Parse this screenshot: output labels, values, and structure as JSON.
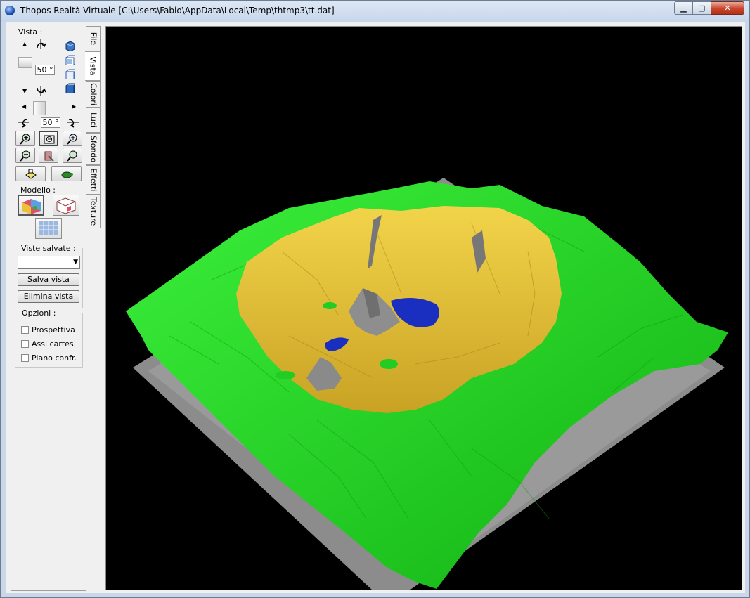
{
  "window": {
    "title": "Thopos Realtà Virtuale [C:\\Users\\Fabio\\AppData\\Local\\Temp\\thtmp3\\tt.dat]",
    "minimize_glyph": "▁",
    "maximize_glyph": "▢",
    "close_glyph": "✕"
  },
  "panel": {
    "vista_label": "Vista :",
    "vertical_angle": "50 °",
    "horizontal_angle": "50 °",
    "modello_label": "Modello :",
    "viste_salvate_label": "Viste salvate :",
    "salva_vista": "Salva vista",
    "elimina_vista": "Elimina vista",
    "opzioni_label": "Opzioni :",
    "options": [
      {
        "label": "Prospettiva",
        "checked": false
      },
      {
        "label": "Assi cartes.",
        "checked": false
      },
      {
        "label": "Piano confr.",
        "checked": false
      }
    ],
    "icons": {
      "rotate_up": "rotate-up-icon",
      "rotate_down": "rotate-down-icon",
      "rotate_left": "rotate-left-icon",
      "rotate_right": "rotate-right-icon",
      "zoom_in": "zoom-in-icon",
      "zoom_out": "zoom-out-icon",
      "fit": "zoom-fit-icon",
      "pan": "pan-icon",
      "light": "light-icon",
      "turtle": "turtle-icon"
    }
  },
  "tabs": [
    {
      "label": "File",
      "active": false
    },
    {
      "label": "Vista",
      "active": true
    },
    {
      "label": "Colori",
      "active": false
    },
    {
      "label": "Luci",
      "active": false
    },
    {
      "label": "Sfondo",
      "active": false
    },
    {
      "label": "Effetti",
      "active": false
    },
    {
      "label": "Texture",
      "active": false
    }
  ],
  "viewport": {
    "background": "#000000",
    "terrain_colors": {
      "grass": "#22dd22",
      "sand": "#e4c030",
      "water": "#1a2fbf",
      "rock": "#909090",
      "base": "#8c8c8c"
    }
  }
}
